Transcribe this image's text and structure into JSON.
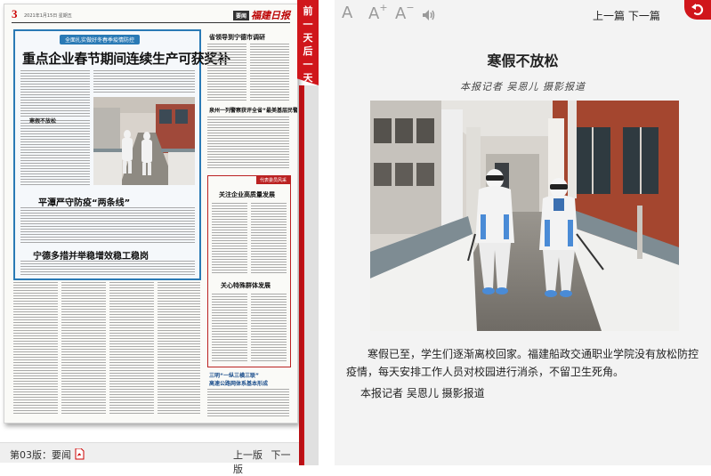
{
  "newspaper": {
    "page_number": "3",
    "masthead_date": "2021年1月15日 星期五",
    "section_tag": "要闻",
    "logo_text": "福建日报",
    "feature_tag": "全面扎实做好冬春季疫情防控",
    "headline": "重点企业春节期间连续生产可获奖补",
    "photo_caption": "寒假不放松",
    "subheadline_1": "平潭严守防疫“两条线”",
    "subheadline_2": "宁德多措并举稳增效稳工稳岗",
    "rc_head_1": "省领导到宁德市调研",
    "rc_head_2": "泉州一列警察获评全省“最美基层民警”",
    "rep_tag": "代表委员风采",
    "rc_head_3": "关注企业高质量发展",
    "rc_head_4": "关心特殊群体发展",
    "rc_head_5": "三明“一纵三横三联”",
    "rc_head_6": "高速公路网体系基本形成"
  },
  "left_footer": {
    "issue_label": "第03版：要闻",
    "prev_page": "上一版",
    "next_page": "下一版"
  },
  "day_tab": {
    "chars": [
      "前",
      "一",
      "天",
      "后",
      "一",
      "天"
    ]
  },
  "toolbar": {
    "font_icons": [
      "A",
      "A",
      "A"
    ],
    "font_suffix_increase": "+",
    "font_suffix_decrease": "−",
    "prev_article": "上一篇",
    "next_article": "下一篇"
  },
  "article": {
    "title": "寒假不放松",
    "byline": "本报记者  吴恩儿  摄影报道",
    "body": "寒假已至，学生们逐渐离校回家。福建船政交通职业学院没有放松防控疫情，每天安排工作人员对校园进行消杀，不留卫生死角。",
    "credit": "本报记者 吴恩儿 摄影报道"
  },
  "colors": {
    "accent_red": "#d0161b",
    "feature_blue": "#2a7ab5",
    "reader_bg": "#f3f3f3"
  }
}
